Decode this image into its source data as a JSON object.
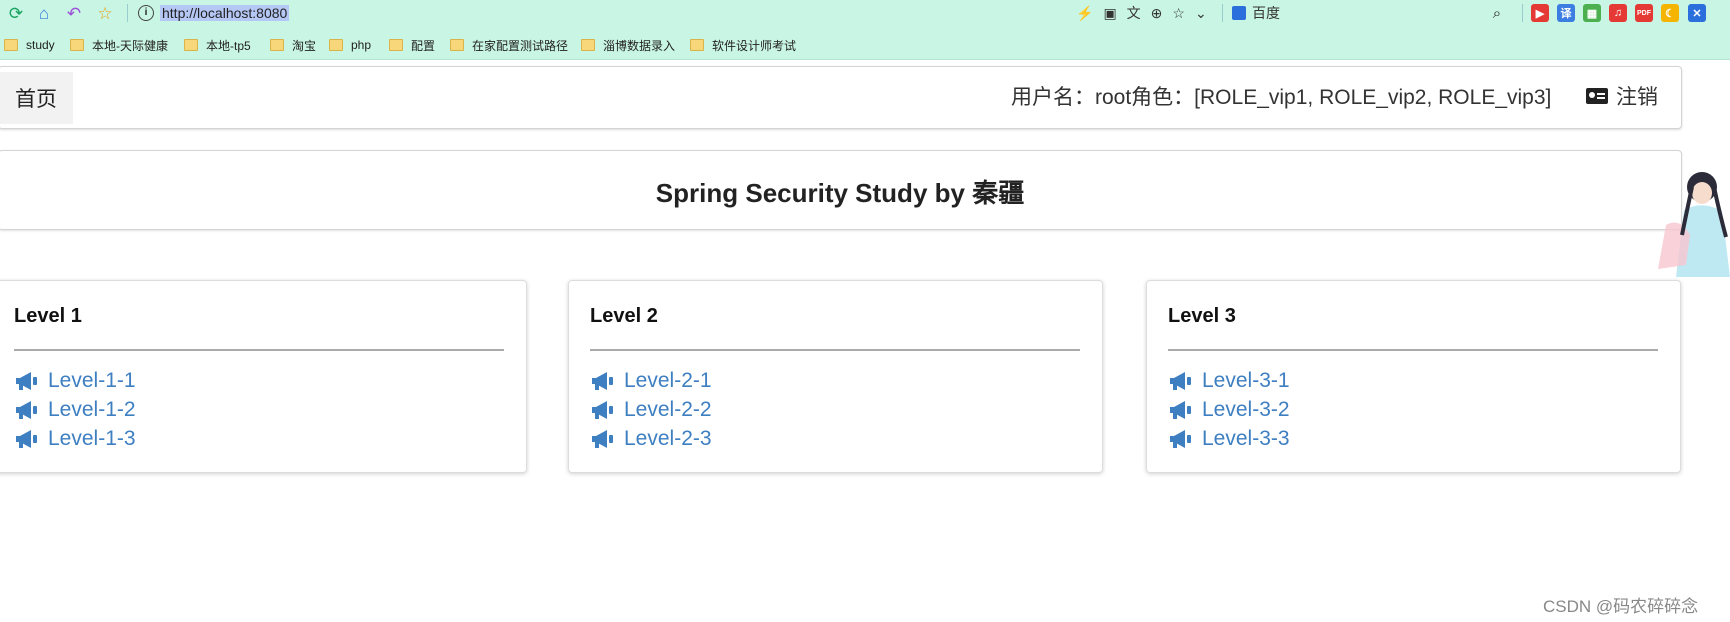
{
  "browser": {
    "url": "http://localhost:8080",
    "search_engine": "百度",
    "nav_icons": [
      "refresh-icon",
      "home-icon",
      "back-icon",
      "star-icon"
    ],
    "tool_icons": [
      "lightning-icon",
      "qr-icon",
      "translate-icon",
      "zoom-icon",
      "star-icon",
      "chevron-down-icon"
    ],
    "extensions": [
      {
        "name": "youtube-ext-icon",
        "color": "#e53935",
        "glyph": "▶"
      },
      {
        "name": "translate-ext-icon",
        "color": "#3b7de0",
        "glyph": "译"
      },
      {
        "name": "apps-ext-icon",
        "color": "#4caf50",
        "glyph": "▦"
      },
      {
        "name": "music-ext-icon",
        "color": "#e53935",
        "glyph": "♫"
      },
      {
        "name": "pdf-ext-icon",
        "color": "#e53935",
        "glyph": "PDF"
      },
      {
        "name": "moon-ext-icon",
        "color": "#f4b400",
        "glyph": "☾"
      },
      {
        "name": "x-ext-icon",
        "color": "#2a6fdb",
        "glyph": "✕"
      }
    ],
    "bookmarks": [
      "study",
      "本地-天际健康",
      "本地-tp5",
      "淘宝",
      "php",
      "配置",
      "在家配置测试路径",
      "淄博数据录入",
      "软件设计师考试"
    ]
  },
  "nav": {
    "home": "首页",
    "user_info": "用户名：root角色：[ROLE_vip1, ROLE_vip2, ROLE_vip3]",
    "logout": "注销"
  },
  "header": {
    "title": "Spring Security Study by 秦疆"
  },
  "levels": [
    {
      "title": "Level 1",
      "links": [
        "Level-1-1",
        "Level-1-2",
        "Level-1-3"
      ]
    },
    {
      "title": "Level 2",
      "links": [
        "Level-2-1",
        "Level-2-2",
        "Level-2-3"
      ]
    },
    {
      "title": "Level 3",
      "links": [
        "Level-3-1",
        "Level-3-2",
        "Level-3-3"
      ]
    }
  ],
  "colors": {
    "link": "#3e7fc1",
    "chrome": "#c9f5e4"
  },
  "watermark": "CSDN @码农碎碎念"
}
